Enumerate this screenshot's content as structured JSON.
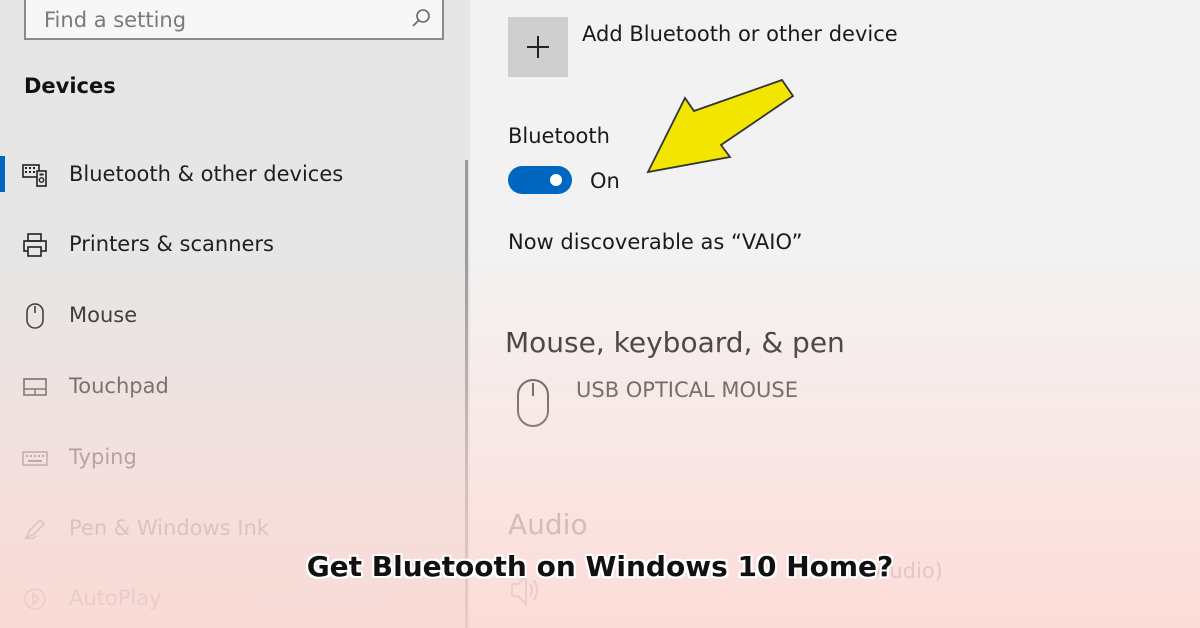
{
  "search": {
    "placeholder": "Find a setting"
  },
  "sidebar": {
    "section_title": "Devices",
    "items": [
      {
        "label": "Bluetooth & other devices",
        "icon": "bluetooth-devices-icon",
        "active": true
      },
      {
        "label": "Printers & scanners",
        "icon": "printer-icon"
      },
      {
        "label": "Mouse",
        "icon": "mouse-icon"
      },
      {
        "label": "Touchpad",
        "icon": "touchpad-icon"
      },
      {
        "label": "Typing",
        "icon": "keyboard-icon"
      },
      {
        "label": "Pen & Windows Ink",
        "icon": "pen-icon"
      },
      {
        "label": "AutoPlay",
        "icon": "autoplay-icon"
      }
    ]
  },
  "main": {
    "add_device_label": "Add Bluetooth or other device",
    "bluetooth_label": "Bluetooth",
    "bluetooth_state": "On",
    "discoverable_text": "Now discoverable as “VAIO”",
    "mouse_section_title": "Mouse, keyboard, & pen",
    "mouse_device": "USB OPTICAL MOUSE",
    "audio_section_title": "Audio",
    "audio_device_partial": "n Audio)"
  },
  "caption": "Get Bluetooth on Windows 10 Home?",
  "colors": {
    "accent": "#0067c0",
    "arrow": "#f2e600"
  }
}
